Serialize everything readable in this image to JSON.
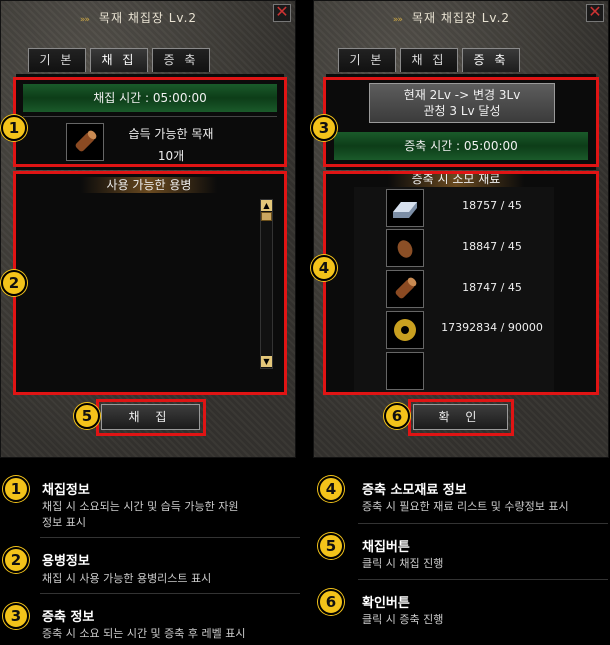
{
  "window": {
    "title": "목재 채집장 Lv.2",
    "title_deco": "»»",
    "close_glyph": "✕"
  },
  "tabs": [
    "기 본",
    "채 집",
    "증 축"
  ],
  "left": {
    "gather_time": "채집 시간 : 05:00:00",
    "item_name": "습득 가능한 목재",
    "item_count": "10개",
    "mercenary_header": "사용 가능한 용병",
    "button": "채 집"
  },
  "right": {
    "upgrade_line1": "현재 2Lv -> 변경 3Lv",
    "upgrade_line2": "관청 3 Lv 달성",
    "upgrade_time": "증축 시간 : 05:00:00",
    "materials_header": "증축 시 소모 재료",
    "materials": [
      {
        "icon": "iron-ingot-icon",
        "value": "18757 / 45"
      },
      {
        "icon": "stone-icon",
        "value": "18847 / 45"
      },
      {
        "icon": "wood-log-icon",
        "value": "18747 / 45"
      },
      {
        "icon": "gold-coin-icon",
        "value": "17392834 / 90000"
      },
      {
        "icon": "empty-slot",
        "value": ""
      }
    ],
    "button": "확 인"
  },
  "legend": [
    {
      "num": "1",
      "title": "채집정보",
      "desc": [
        "채집 시 소요되는 시간 및 습득 가능한 자원",
        "정보 표시"
      ]
    },
    {
      "num": "2",
      "title": "용병정보",
      "desc": [
        "채집 시 사용 가능한 용병리스트 표시"
      ]
    },
    {
      "num": "3",
      "title": "증축 정보",
      "desc": [
        "증축 시 소요 되는 시간 및 증축 후 레벨 표시"
      ]
    },
    {
      "num": "4",
      "title": "증축 소모재료 정보",
      "desc": [
        "증축 시 필요한 재료 리스트 및 수량정보 표시"
      ]
    },
    {
      "num": "5",
      "title": "채집버튼",
      "desc": [
        "클릭 시 채집 진행"
      ]
    },
    {
      "num": "6",
      "title": "확인버튼",
      "desc": [
        "클릭 시 증축 진행"
      ]
    }
  ],
  "colors": {
    "highlight": "#e01414",
    "marker": "#f3c31a",
    "green": "#0d3d18"
  }
}
